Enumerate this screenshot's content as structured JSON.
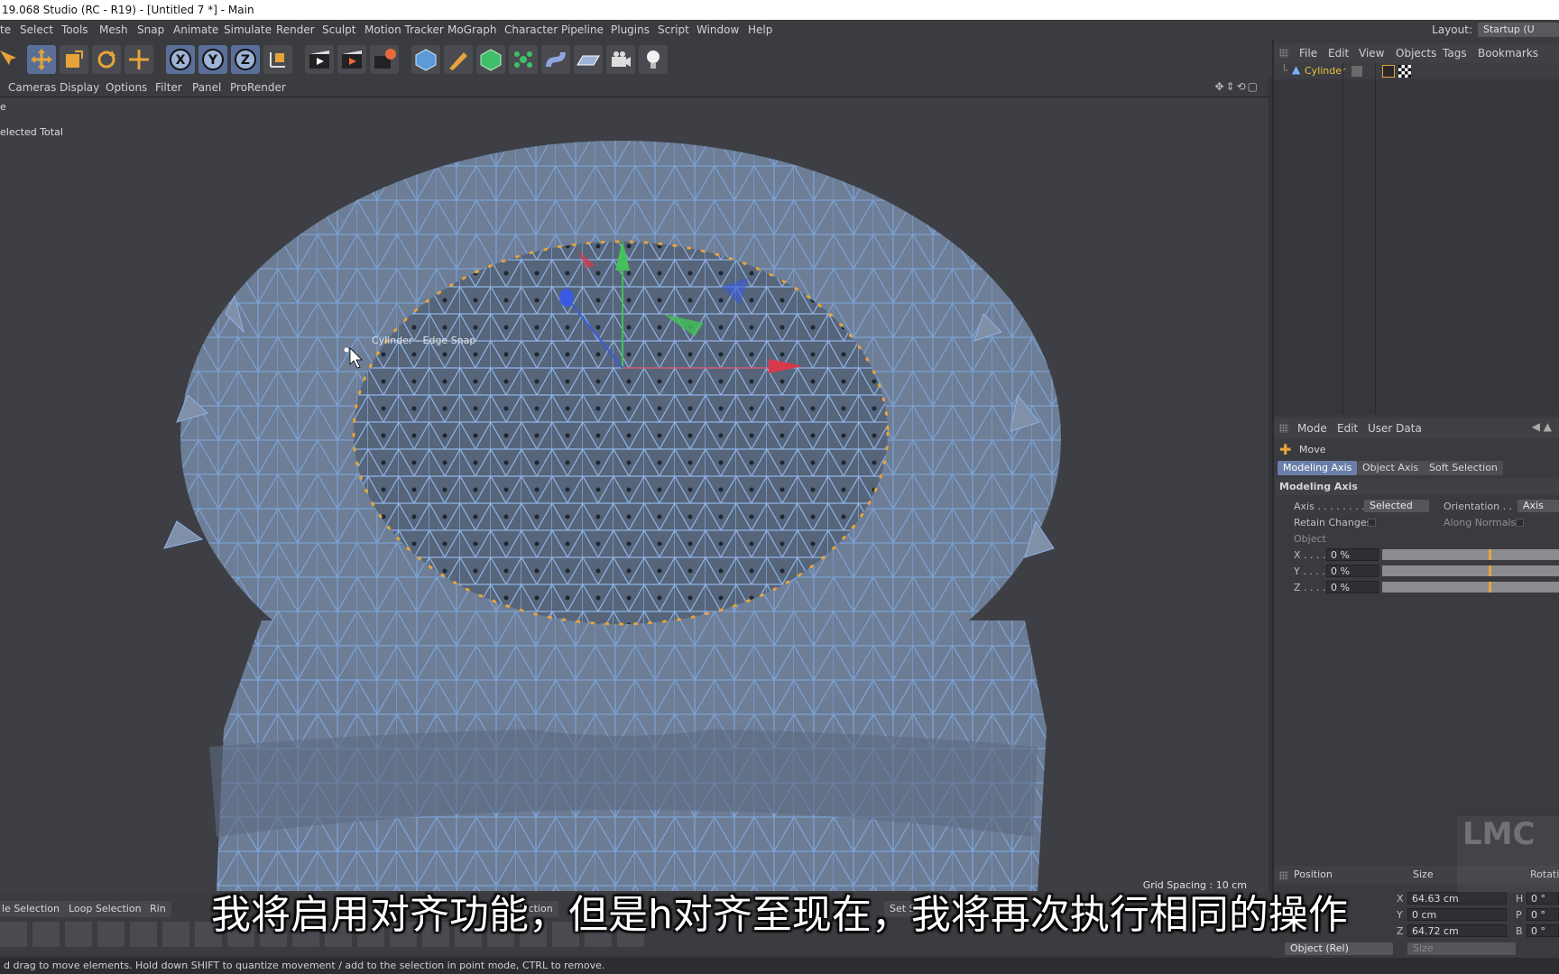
{
  "window": {
    "title": "19.068 Studio (RC - R19) - [Untitled 7 *] - Main"
  },
  "menubar": {
    "items": [
      "te",
      "Select",
      "Tools",
      "Mesh",
      "Snap",
      "Animate",
      "Simulate",
      "Render",
      "Sculpt",
      "Motion Tracker",
      "MoGraph",
      "Character",
      "Pipeline",
      "Plugins",
      "Script",
      "Window",
      "Help"
    ],
    "layout_label": "Layout:",
    "layout_value": "Startup (U"
  },
  "viewport_menu": {
    "items": [
      "Cameras",
      "Display",
      "Options",
      "Filter",
      "Panel",
      "ProRender"
    ]
  },
  "viewport": {
    "hud_line_1": "e",
    "hud_line_2": "elected Total",
    "snap_tooltip": "Cylinder - Edge Snap",
    "grid_spacing": "Grid Spacing : 10 cm"
  },
  "object_manager": {
    "menu": [
      "File",
      "Edit",
      "View",
      "Objects",
      "Tags",
      "Bookmarks"
    ],
    "objects": [
      {
        "name": "Cylinder"
      }
    ]
  },
  "attribute_manager": {
    "menu": [
      "Mode",
      "Edit",
      "User Data"
    ],
    "tool_name": "Move",
    "tabs": [
      "Modeling Axis",
      "Object Axis",
      "Soft Selection"
    ],
    "section_title": "Modeling Axis",
    "axis_label": "Axis . . . . . . . . . .",
    "axis_value": "Selected",
    "orientation_label": "Orientation . .",
    "orientation_value": "Axis",
    "retain_changes_label": "Retain Changes",
    "along_normals_label": "Along Normals",
    "object_label": "Object",
    "x_label": "X . . . .",
    "y_label": "Y . . . .",
    "z_label": "Z . . . .",
    "x_value": "0 %",
    "y_value": "0 %",
    "z_value": "0 %"
  },
  "coordinates": {
    "position_label": "Position",
    "size_label": "Size",
    "rotation_label": "Rotati",
    "x_size": "64.63 cm",
    "y_size": "0 cm",
    "z_size": "64.72 cm",
    "h_value": "0 °",
    "p_value": "0 °",
    "b_value": "0 °",
    "x_axis": "X",
    "y_axis": "Y",
    "z_axis": "Z",
    "h_axis": "H",
    "p_axis": "P",
    "b_axis": "B",
    "mode_select": "Object (Rel)",
    "size_select": "Size"
  },
  "bottom_toolbar": {
    "tabs": [
      "le Selection",
      "Loop Selection",
      "Rin",
      "Selection",
      "Set Se"
    ]
  },
  "status_bar": "d drag to move elements. Hold down SHIFT to quantize movement / add to the selection in point mode, CTRL to remove.",
  "subtitle": "我将启用对齐功能，但是h对齐至现在，我将再次执行相同的操作",
  "watermark": "LMC",
  "colors": {
    "accent": "#e7a33a",
    "selection_blue": "#6a7fa8",
    "mesh_edge": "#8fb3e6"
  }
}
